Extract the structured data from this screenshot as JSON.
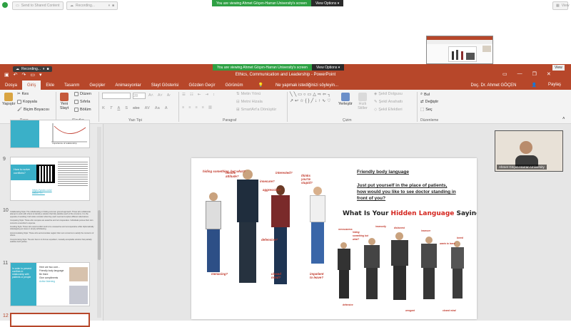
{
  "zoom": {
    "share_button": "Send to Shared Content",
    "recording_label": "Recording...",
    "viewing_banner": "You are viewing Ahmet Göçen-Harran University's screen",
    "view_options": "View Options",
    "small_view_label": "View"
  },
  "ppt": {
    "recording_label": "Recording...",
    "viewing_banner": "You are viewing Ahmet Göçen-Harran University's screen",
    "view_options": "View Options",
    "view_label": "View",
    "title": "Ethics, Communication and Leadership - PowerPoint",
    "tabs": [
      "Dosya",
      "Giriş",
      "Ekle",
      "Tasarım",
      "Geçişler",
      "Animasyonlar",
      "Slayt Gösterisi",
      "Gözden Geçir",
      "Görünüm"
    ],
    "tell_me": "Ne yapmak istediğinizi söyleyin...",
    "user": "Doç. Dr. Ahmet GÖÇEN",
    "share": "Paylaş",
    "clipboard": {
      "paste": "Yapıştır",
      "cut": "Kes",
      "copy": "Kopyala",
      "format_painter": "Biçim Boyacısı",
      "label": "Pano"
    },
    "slides": {
      "new_slide": "Yeni Slayt",
      "layout": "Düzen",
      "reset": "Sıfırla",
      "section": "Bölüm",
      "label": "Slaytlar"
    },
    "font": {
      "size": "28",
      "bold": "K",
      "italic": "T",
      "underline": "A",
      "strike": "S",
      "shadow": "abc",
      "label": "Yazı Tipi"
    },
    "paragraph": {
      "text_dir": "Metin Yönü",
      "align_text": "Metni Hizala",
      "smartart": "SmartArt'a Dönüştür",
      "label": "Paragraf"
    },
    "drawing": {
      "arrange": "Yerleştir",
      "quick_styles": "Hızlı Stiller",
      "fill": "Şekil Dolgusu",
      "outline": "Şekil Anahattı",
      "effects": "Şekil Efektleri",
      "label": "Çizim"
    },
    "editing": {
      "find": "Bul",
      "replace": "Değiştir",
      "select": "Seç",
      "label": "Düzenleme"
    }
  },
  "thumbs": {
    "s8_caption": "Importance of relationship",
    "s9_title": "How to solve conflicts?",
    "s9_link": "https://youtu.com/ watch?v=...",
    "s11_title": "In order to prevent conflicts in relationship with patients or people",
    "s11_items": [
      "Here are two core...",
      "Friendly body language",
      "Be there",
      "Give compliments",
      "Active listening"
    ],
    "numbers": [
      "9",
      "10",
      "11",
      "12"
    ],
    "notes_10": [
      "Collaborating Style: The collaborating or finding common ground approach. Those who collaborate attempt to work with others to identify a solution that fully satisfies each of the concerns. It is the opposite of avoiding: both sides consider what they each need and explore different alternatives.",
      "Competing Style: Those who compete are assertive and not cooperative. Individuals pursue their own concerns at another's expense.",
      "Avoiding Style: Those who avoid conflict tend to be unassertive and uncooperative while diplomatically sidestepping an issue or simply withdrawing.",
      "Accommodating Style: Those who accommodate neglect their own concerns to satisfy the concerns of others.",
      "Compromising Style: The aim here is to find an expedient, mutually acceptable solution that partially satisfies both parties."
    ]
  },
  "main_slide": {
    "text1": "Friendly body language",
    "text2": "Just put yourself in the place of patients, how would you like to see doctor standing in front of you?",
    "heading_pre": "What Is Your ",
    "heading_red": "Hidden Language",
    "heading_post": " Saying?",
    "left_labels": [
      "hiding something, but what?",
      "hostile attitude?",
      "interested?",
      "thinks you're stupid?",
      "insecure?",
      "aggressive?",
      "defensive?",
      "menacing?",
      "closed mind?",
      "impatient to leave?"
    ],
    "right_labels": [
      "nervousness",
      "hiding something but what?",
      "insecurity",
      "dishonest",
      "insecure",
      "wants to leave",
      "bored",
      "defensive",
      "arrogant",
      "closed mind"
    ]
  },
  "video": {
    "name": "Ahmet Göçen-Harran University"
  },
  "colors": {
    "ppt_red": "#b7472a",
    "zoom_green": "#2ea043",
    "accent_teal": "#3ab0c8",
    "label_red": "#c0392b"
  }
}
